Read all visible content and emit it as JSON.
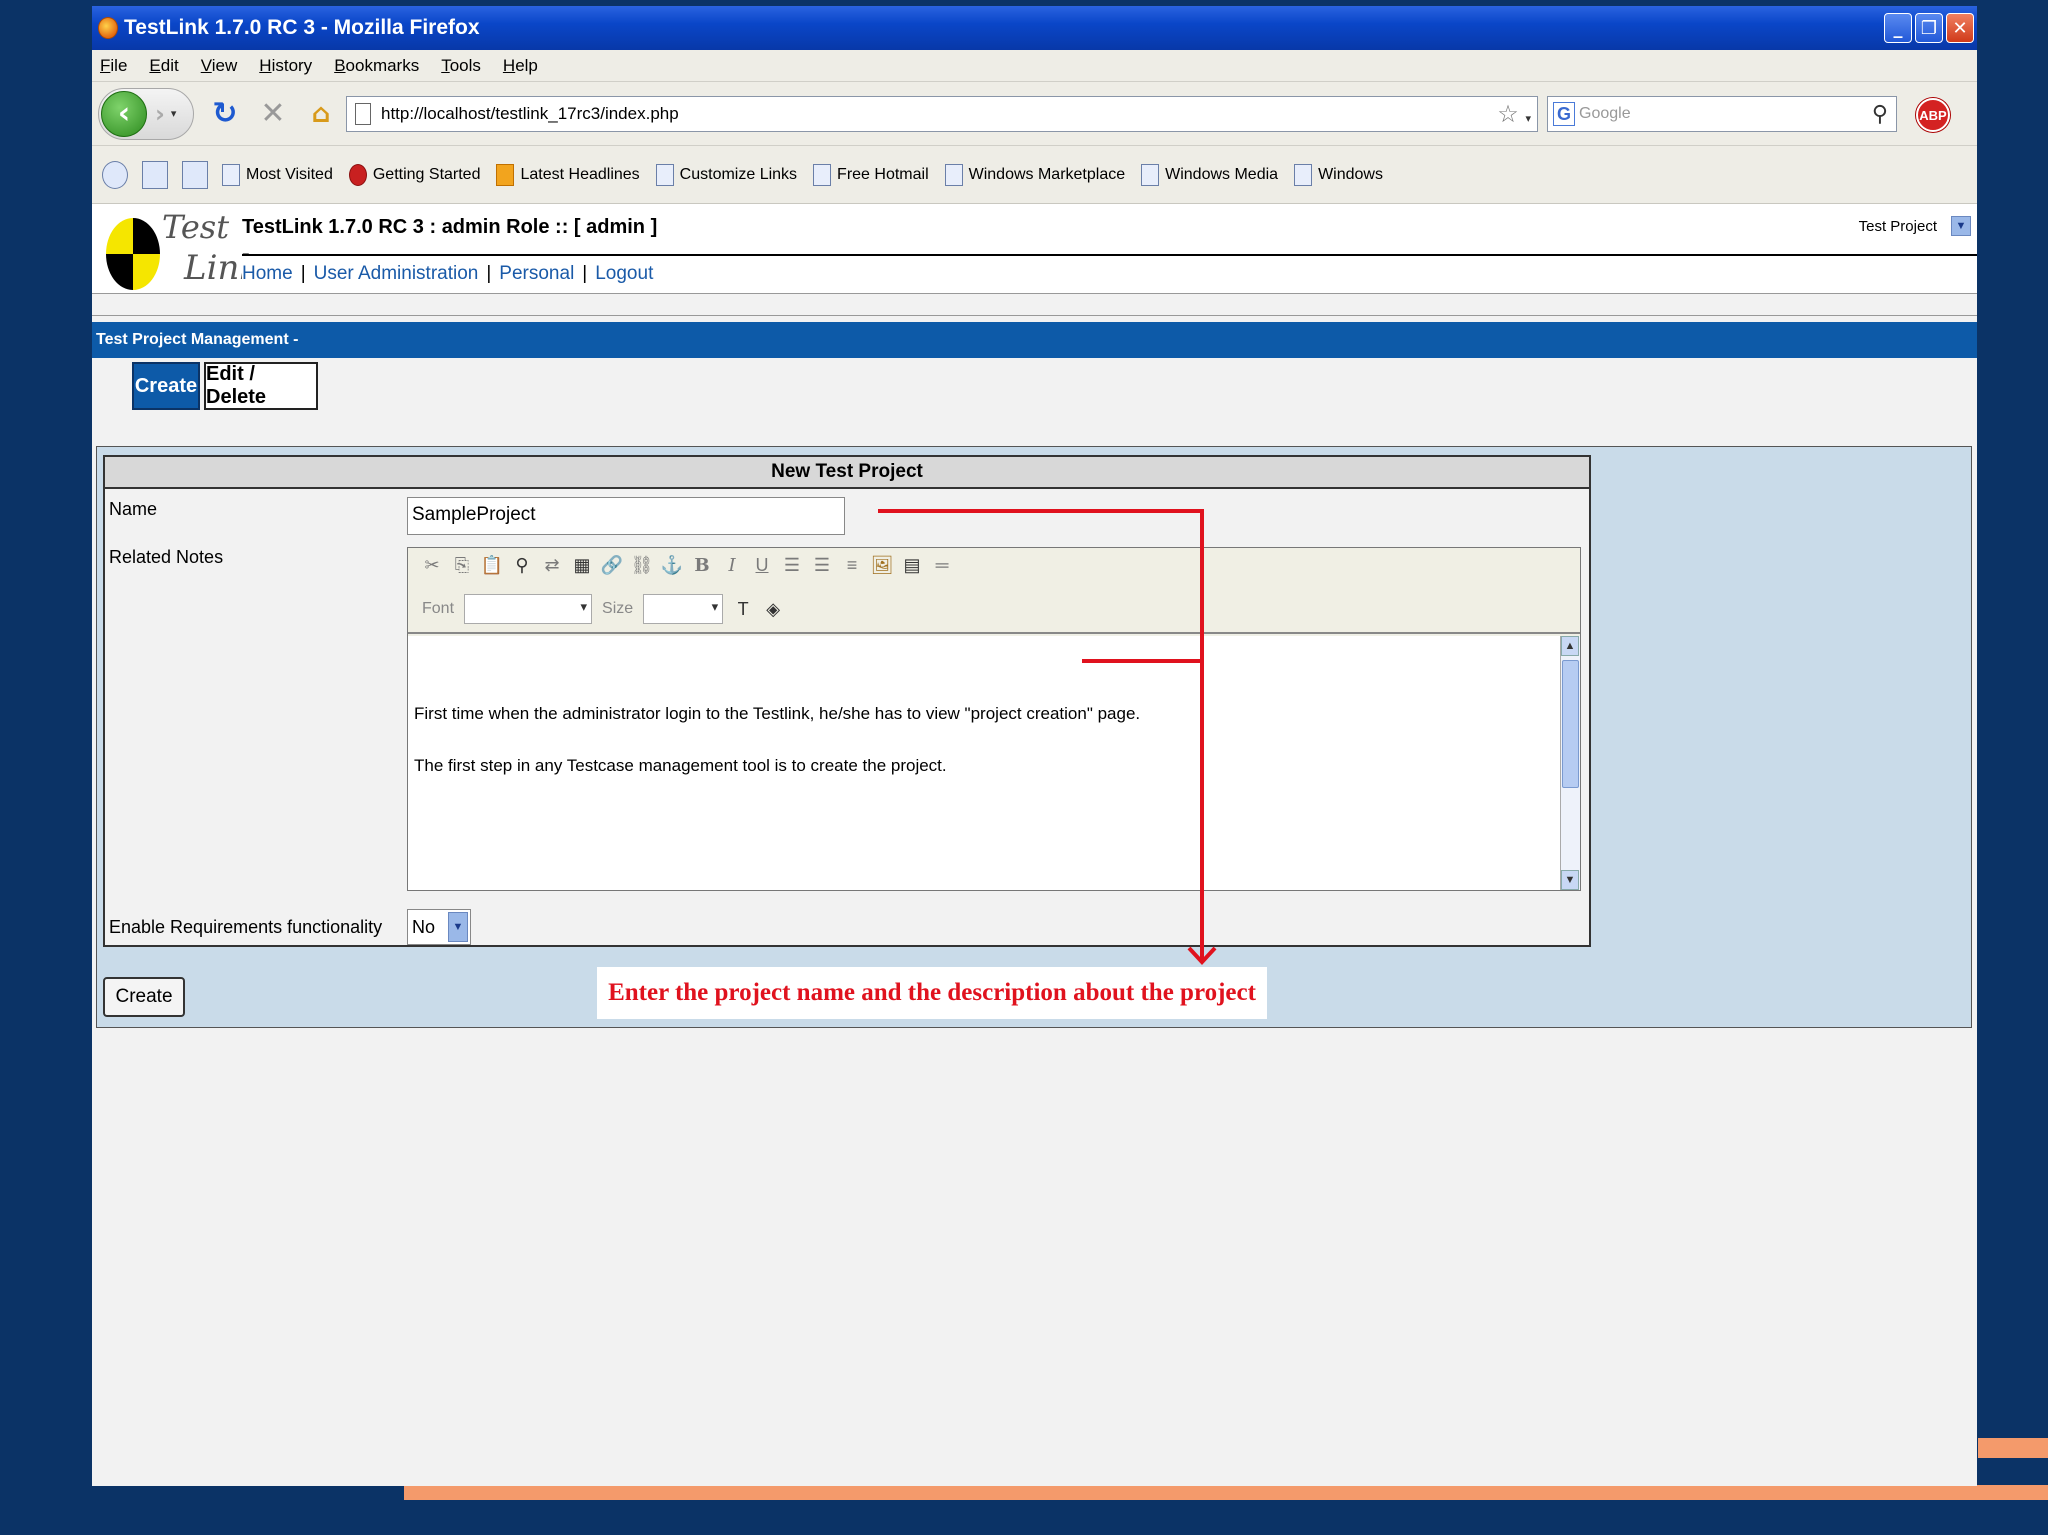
{
  "browser": {
    "title": "TestLink 1.7.0 RC 3 - Mozilla Firefox",
    "menu": [
      "File",
      "Edit",
      "View",
      "History",
      "Bookmarks",
      "Tools",
      "Help"
    ],
    "url": "http://localhost/testlink_17rc3/index.php",
    "search_placeholder": "Google",
    "bookmarks": [
      "Most Visited",
      "Getting Started",
      "Latest Headlines",
      "Customize Links",
      "Free Hotmail",
      "Windows Marketplace",
      "Windows Media",
      "Windows"
    ],
    "abp_label": "ABP"
  },
  "app": {
    "logo_top": "Test",
    "logo_bottom": "Link",
    "title": "TestLink 1.7.0 RC 3 : admin Role :: [ admin ]",
    "nav": [
      "Home",
      "User Administration",
      "Personal",
      "Logout"
    ],
    "test_project_label": "Test Project",
    "section_title": "Test Project Management -",
    "tabs": {
      "create": "Create",
      "edit_delete": "Edit / Delete"
    }
  },
  "form": {
    "header": "New Test Project",
    "name_label": "Name",
    "name_value": "SampleProject",
    "notes_label": "Related Notes",
    "editor_font_label": "Font",
    "editor_size_label": "Size",
    "notes_lines": [
      "First time when the administrator login to the Testlink, he/she has to view \"project creation\" page.",
      "The first step in any Testcase management tool is to create the project."
    ],
    "req_label": "Enable Requirements functionality",
    "req_value": "No",
    "create_button": "Create"
  },
  "annotation": "Enter the project name and the description about the project",
  "colors": {
    "accent": "#0d5aa8",
    "annotation": "#e0121e",
    "background": "#0b3366",
    "orange": "#f49a6b"
  }
}
